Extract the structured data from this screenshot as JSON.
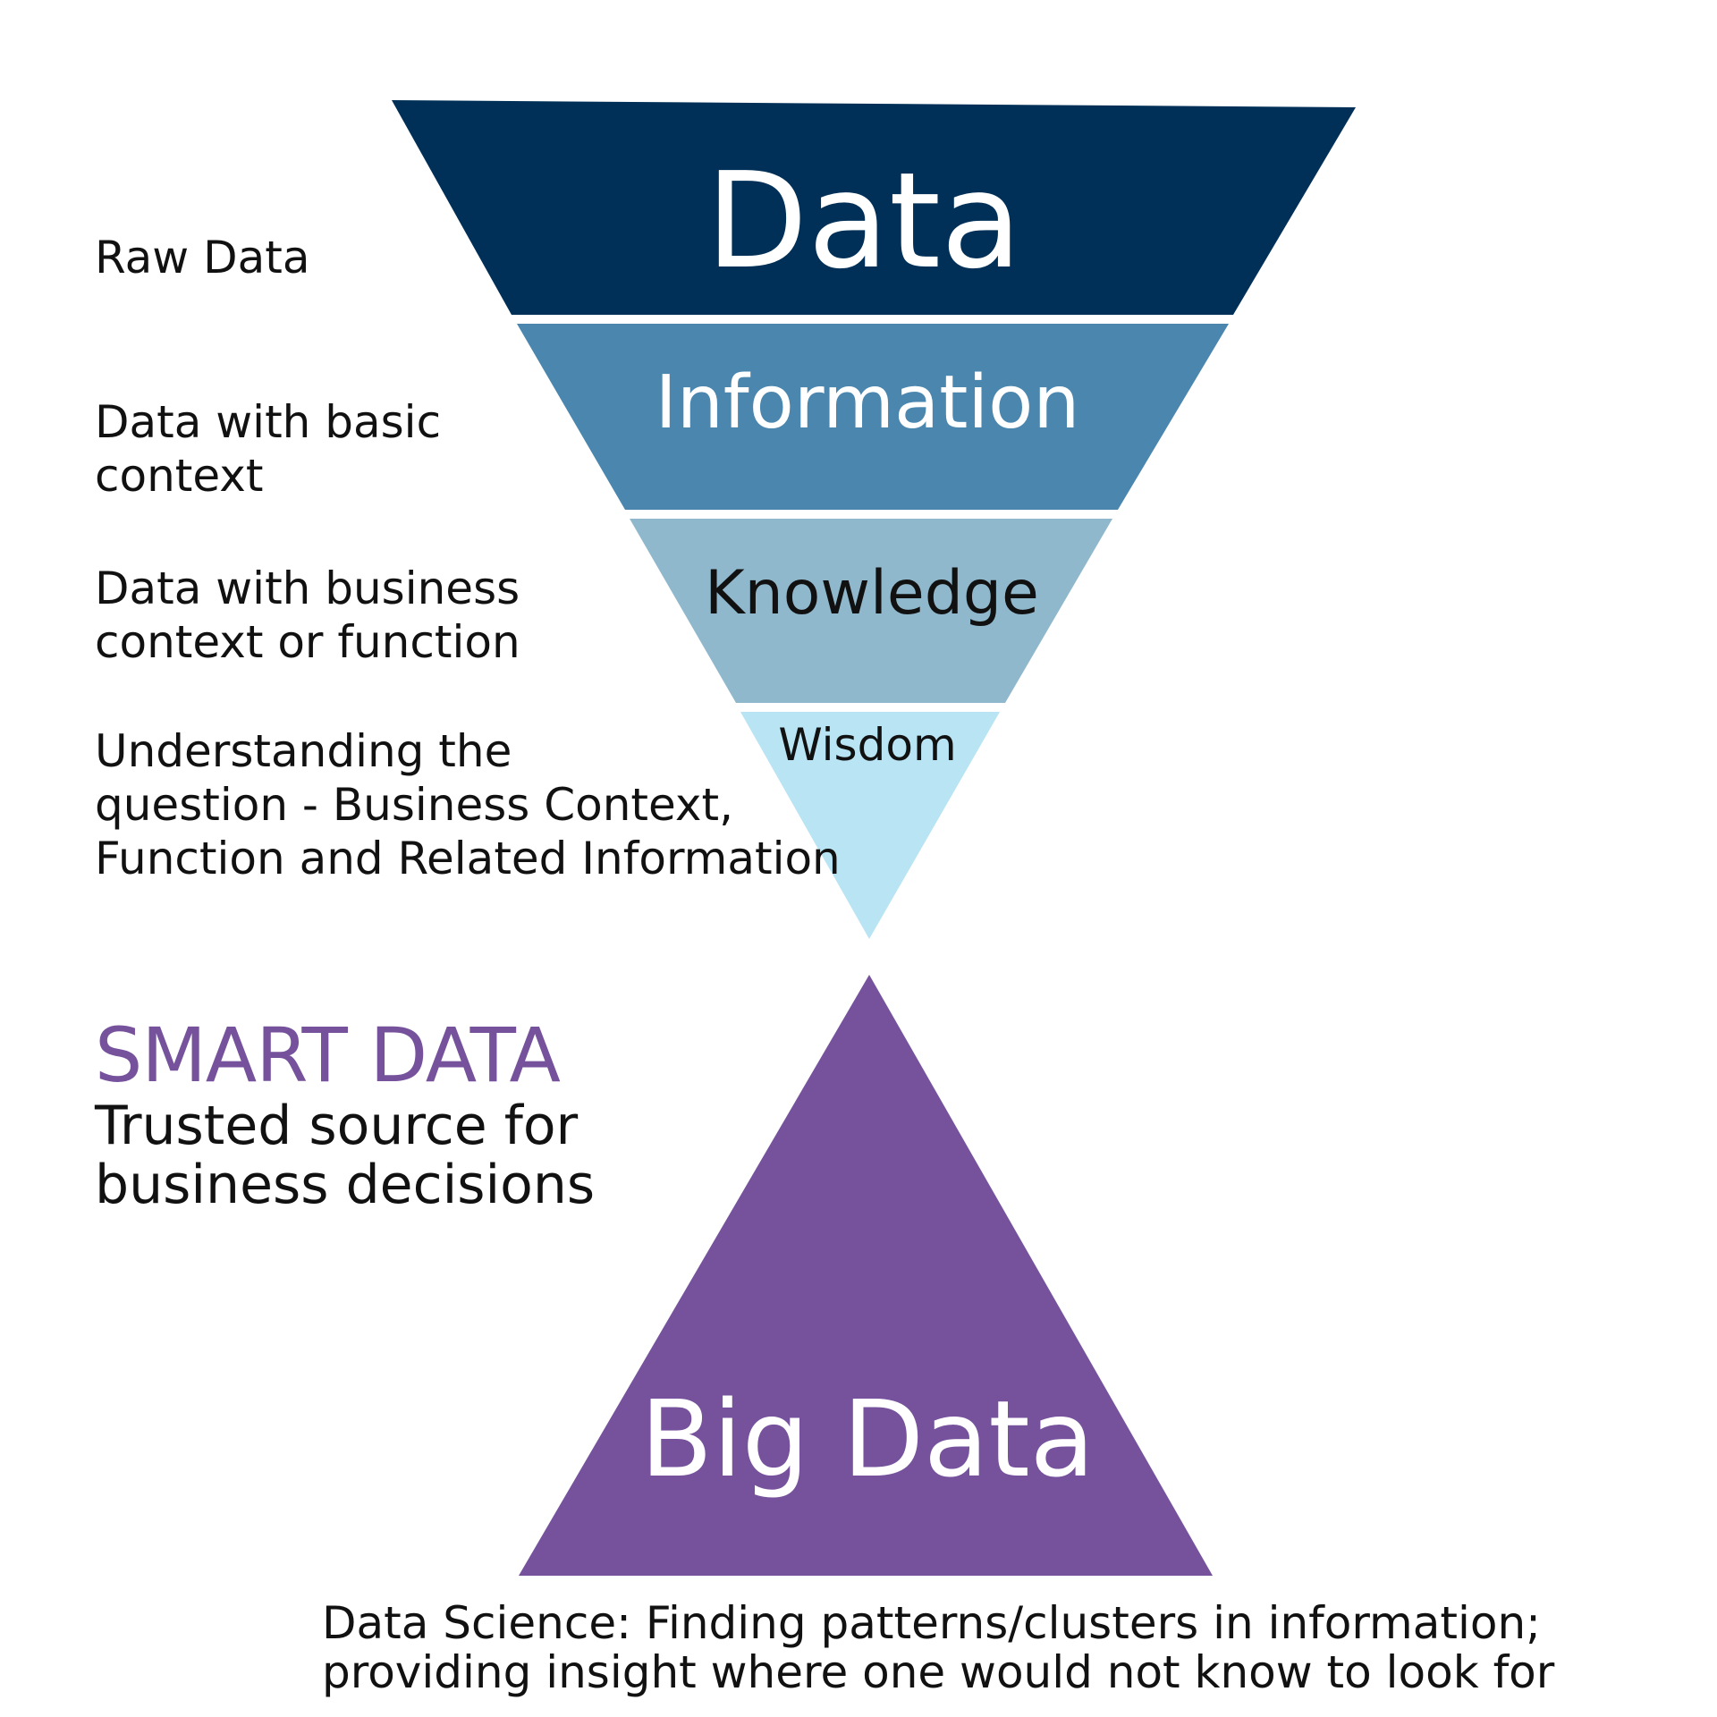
{
  "funnel": {
    "layers": [
      {
        "label": "Data",
        "color": "#003057",
        "text_color": "#ffffff"
      },
      {
        "label": "Information",
        "color": "#4a86ae",
        "text_color": "#ffffff"
      },
      {
        "label": "Knowledge",
        "color": "#90b8cc",
        "text_color": "#111111"
      },
      {
        "label": "Wisdom",
        "color": "#b8e4f4",
        "text_color": "#111111"
      }
    ]
  },
  "descriptions": [
    "Raw Data",
    "Data with basic\ncontext",
    "Data with business\ncontext or function",
    "Understanding the\nquestion - Business Context,\nFunction and Related Information"
  ],
  "smart_data": {
    "title": "SMART DATA",
    "description": "Trusted source for\nbusiness decisions",
    "color": "#76529c"
  },
  "big_data": {
    "label": "Big Data",
    "color": "#76529c"
  },
  "footer": "Data Science: Finding patterns/clusters in information;\nproviding insight where one would not know to look for"
}
